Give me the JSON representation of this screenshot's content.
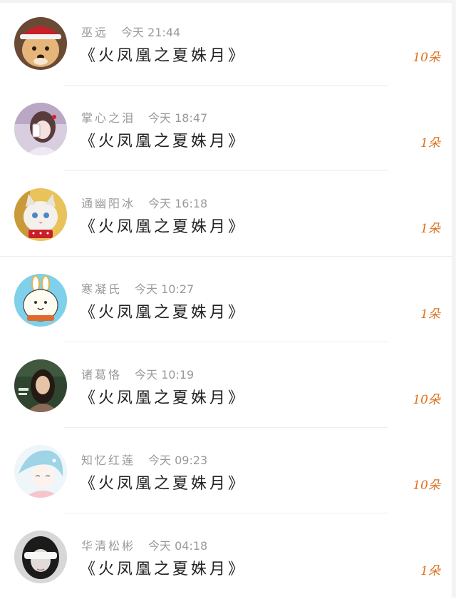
{
  "gifts": [
    {
      "name": "巫远",
      "time": "今天 21:44",
      "title": "《火凤凰之夏姝月》",
      "count": "10朵",
      "avatar": "dog-avatar"
    },
    {
      "name": "掌心之泪",
      "time": "今天 18:47",
      "title": "《火凤凰之夏姝月》",
      "count": "1朵",
      "avatar": "girl-selfie-avatar"
    },
    {
      "name": "通幽阳冰",
      "time": "今天 16:18",
      "title": "《火凤凰之夏姝月》",
      "count": "1朵",
      "avatar": "cat-avatar"
    },
    {
      "name": "寒凝氏",
      "time": "今天 10:27",
      "title": "《火凤凰之夏姝月》",
      "count": "1朵",
      "avatar": "cartoon-bunny-avatar"
    },
    {
      "name": "诸葛恪",
      "time": "今天 10:19",
      "title": "《火凤凰之夏姝月》",
      "count": "10朵",
      "avatar": "woman-photo-avatar"
    },
    {
      "name": "知忆红莲",
      "time": "今天 09:23",
      "title": "《火凤凰之夏姝月》",
      "count": "10朵",
      "avatar": "anime-girl-avatar"
    },
    {
      "name": "华清松彬",
      "time": "今天 04:18",
      "title": "《火凤凰之夏姝月》",
      "count": "1朵",
      "avatar": "blindfold-girl-avatar"
    }
  ],
  "colors": {
    "count": "#e0701e",
    "meta": "#999999",
    "title": "#222222"
  }
}
